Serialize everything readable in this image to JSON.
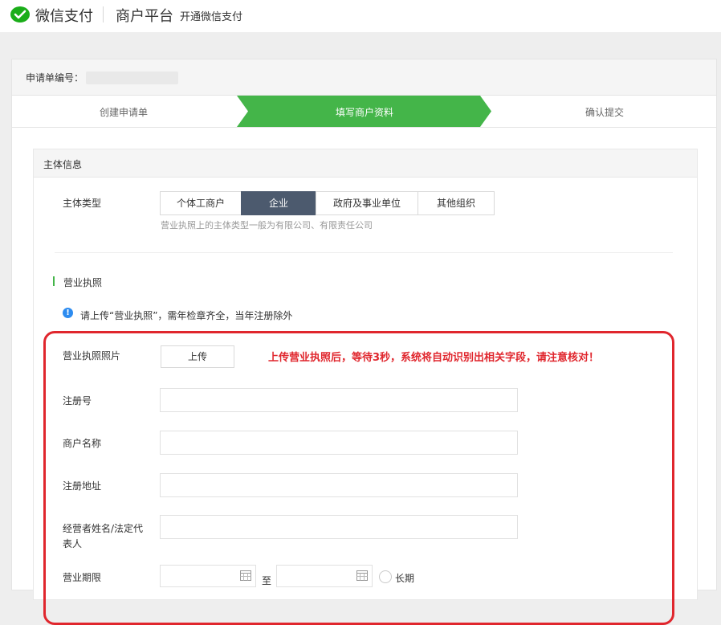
{
  "header": {
    "brand": "微信支付",
    "platform": "商户平台",
    "subtitle": "开通微信支付"
  },
  "application": {
    "label": "申请单编号："
  },
  "steps": [
    {
      "label": "创建申请单"
    },
    {
      "label": "填写商户资料"
    },
    {
      "label": "确认提交"
    }
  ],
  "subject": {
    "title": "主体信息",
    "type_label": "主体类型",
    "options": [
      "个体工商户",
      "企业",
      "政府及事业单位",
      "其他组织"
    ],
    "selected": "企业",
    "hint": "营业执照上的主体类型一般为有限公司、有限责任公司"
  },
  "license": {
    "title": "营业执照",
    "info": "请上传“营业执照”，需年检章齐全，当年注册除外",
    "photo_label": "营业执照照片",
    "upload_label": "上传",
    "note": "上传营业执照后，等待3秒，系统将自动识别出相关字段，请注意核对！",
    "reg_no_label": "注册号",
    "merchant_name_label": "商户名称",
    "reg_address_label": "注册地址",
    "legal_rep_label_line1": "经营者姓名/法定代",
    "legal_rep_label_line2": "表人",
    "period_label": "营业期限",
    "to_label": "至",
    "long_term_label": "长期"
  },
  "colors": {
    "active_step": "#44b549",
    "active_segment": "#4c5a6e",
    "highlight_red": "#e0262d",
    "info_blue": "#2d8cf0"
  }
}
